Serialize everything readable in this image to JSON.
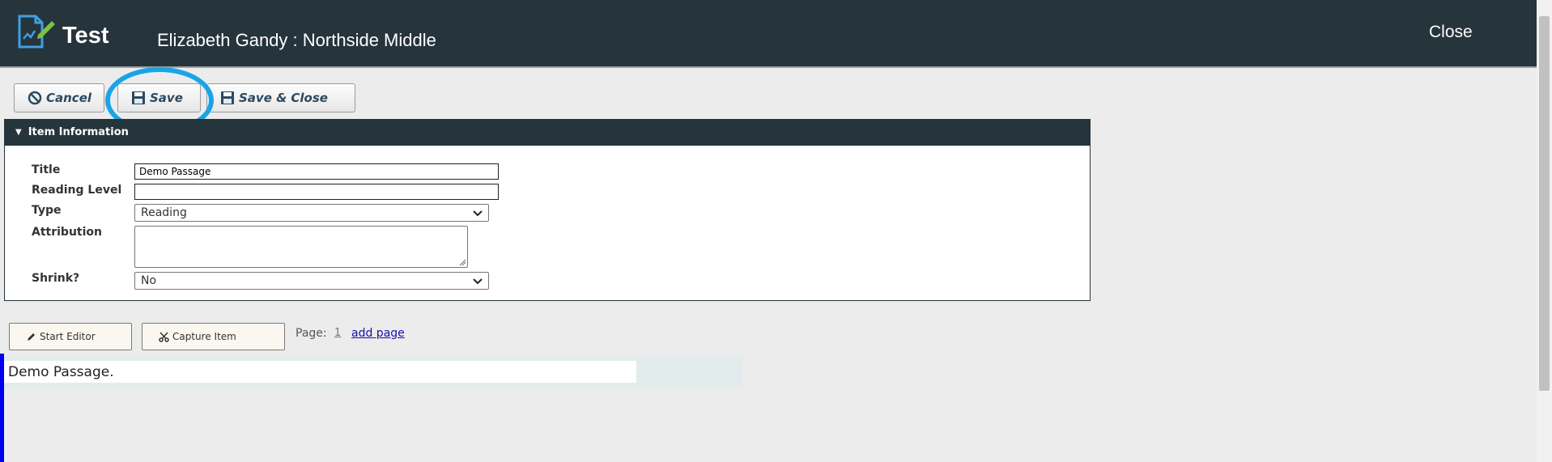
{
  "header": {
    "app_title": "Test",
    "subtitle": "Elizabeth Gandy : Northside Middle",
    "close_label": "Close",
    "bg_color": "#26343c"
  },
  "toolbar": {
    "cancel_label": "Cancel",
    "save_label": "Save",
    "save_close_label": "Save & Close",
    "highlight_color": "#1aa4e8"
  },
  "item_info": {
    "section_title": "Item Information",
    "fields": {
      "title_label": "Title",
      "title_value": "Demo Passage",
      "reading_level_label": "Reading Level",
      "reading_level_value": "",
      "type_label": "Type",
      "type_value": "Reading",
      "attribution_label": "Attribution",
      "attribution_value": "",
      "shrink_label": "Shrink?",
      "shrink_value": "No"
    }
  },
  "editor": {
    "start_editor_label": "Start Editor",
    "capture_item_label": "Capture Item",
    "page_label": "Page:",
    "page_number": "1",
    "add_page_label": "add page"
  },
  "content": {
    "text": "Demo Passage."
  }
}
